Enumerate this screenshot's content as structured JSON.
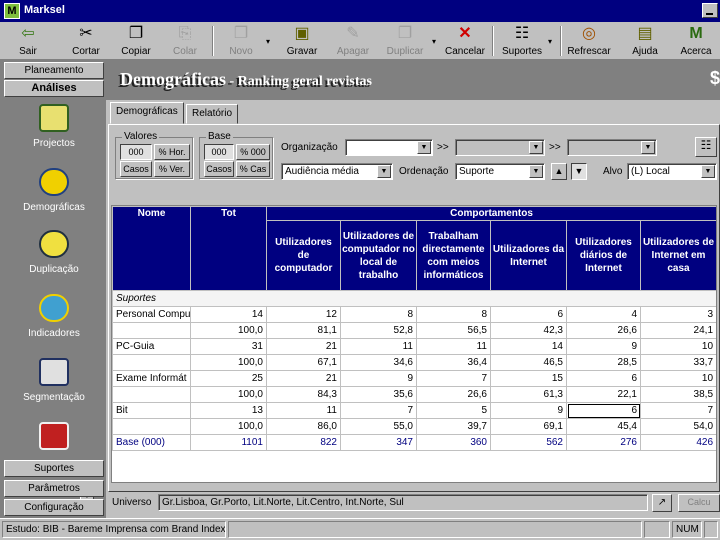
{
  "window": {
    "title": "Marksel",
    "app_icon_letter": "M"
  },
  "toolbar": {
    "buttons": [
      {
        "label": "Sair",
        "icon": "exit-icon",
        "enabled": true
      },
      {
        "label": "Cortar",
        "icon": "scissors-icon",
        "enabled": true
      },
      {
        "label": "Copiar",
        "icon": "copy-icon",
        "enabled": true
      },
      {
        "label": "Colar",
        "icon": "paste-icon",
        "enabled": false
      },
      {
        "label": "Novo",
        "icon": "new-icon",
        "enabled": false
      },
      {
        "label": "Gravar",
        "icon": "save-icon",
        "enabled": true
      },
      {
        "label": "Apagar",
        "icon": "erase-icon",
        "enabled": false
      },
      {
        "label": "Duplicar",
        "icon": "duplicate-icon",
        "enabled": false
      },
      {
        "label": "Cancelar",
        "icon": "cancel-icon",
        "enabled": true
      },
      {
        "label": "Suportes",
        "icon": "media-icon",
        "enabled": true
      },
      {
        "label": "Refrescar",
        "icon": "refresh-icon",
        "enabled": true
      },
      {
        "label": "Ajuda",
        "icon": "help-book-icon",
        "enabled": true
      },
      {
        "label": "Acerca",
        "icon": "about-icon",
        "enabled": true
      }
    ]
  },
  "sidebar": {
    "headers_top": [
      "Planeamento",
      "Análises"
    ],
    "items": [
      "Projectos",
      "Demográficas",
      "Duplicação",
      "Indicadores",
      "Segmentação"
    ],
    "headers_bottom": [
      "Suportes",
      "Parâmetros",
      "Configuração"
    ]
  },
  "banner": {
    "title": "Demográficas",
    "subtitle": " - Ranking geral revistas",
    "suffix": "$"
  },
  "tabs": [
    "Demográficas",
    "Relatório"
  ],
  "controls": {
    "valores": {
      "label": "Valores",
      "b1": "000",
      "b2": "% Hor.",
      "b3": "Casos",
      "b4": "% Ver."
    },
    "base": {
      "label": "Base",
      "b1": "000",
      "b2": "% 000",
      "b3": "Casos",
      "b4": "% Cas"
    },
    "organizacao_label": "Organização",
    "organizacao_value": "",
    "chevrons": ">>",
    "audiencia_value": "Audiência média",
    "ordenacao_label": "Ordenação",
    "ordenacao_value": "Suporte",
    "alvo_label": "Alvo",
    "alvo_value": "(L) Local"
  },
  "table": {
    "col_nome": "Nome",
    "col_tot": "Tot",
    "group_header": "Comportamentos",
    "sub_headers": [
      "Utilizadores de computador",
      "Utilizadores de computador no local de trabalho",
      "Trabalham directamente com meios informáticos",
      "Utilizadores da Internet",
      "Utilizadores diários de Internet",
      "Utilizadores de Internet em casa"
    ],
    "group_row": "Suportes",
    "rows": [
      {
        "name": "Personal Compu",
        "values": [
          "14",
          "12",
          "8",
          "8",
          "6",
          "4",
          "3"
        ]
      },
      {
        "name": "",
        "values": [
          "100,0",
          "81,1",
          "52,8",
          "56,5",
          "42,3",
          "26,6",
          "24,1"
        ]
      },
      {
        "name": "PC-Guia",
        "values": [
          "31",
          "21",
          "11",
          "11",
          "14",
          "9",
          "10"
        ]
      },
      {
        "name": "",
        "values": [
          "100,0",
          "67,1",
          "34,6",
          "36,4",
          "46,5",
          "28,5",
          "33,7"
        ]
      },
      {
        "name": "Exame Informát",
        "values": [
          "25",
          "21",
          "9",
          "7",
          "15",
          "6",
          "10"
        ]
      },
      {
        "name": "",
        "values": [
          "100,0",
          "84,3",
          "35,6",
          "26,6",
          "61,3",
          "22,1",
          "38,5"
        ]
      },
      {
        "name": "Bit",
        "values": [
          "13",
          "11",
          "7",
          "5",
          "9",
          "6",
          "7"
        ]
      },
      {
        "name": "",
        "values": [
          "100,0",
          "86,0",
          "55,0",
          "39,7",
          "69,1",
          "45,4",
          "54,0"
        ]
      }
    ],
    "base_row": {
      "name": "Base (000)",
      "values": [
        "1101",
        "822",
        "347",
        "360",
        "562",
        "276",
        "426"
      ]
    }
  },
  "universo": {
    "label": "Universo",
    "value": "Gr.Lisboa, Gr.Porto, Lit.Norte, Lit.Centro, Int.Norte, Sul",
    "calc_label": "Calcu"
  },
  "statusbar": {
    "text": "Estudo: BIB - Bareme Imprensa com Brand Index",
    "num": "NUM"
  },
  "colors": {
    "header_bg": "#000080",
    "window_bg": "#c0c0c0",
    "sidebar_bg": "#808080"
  }
}
